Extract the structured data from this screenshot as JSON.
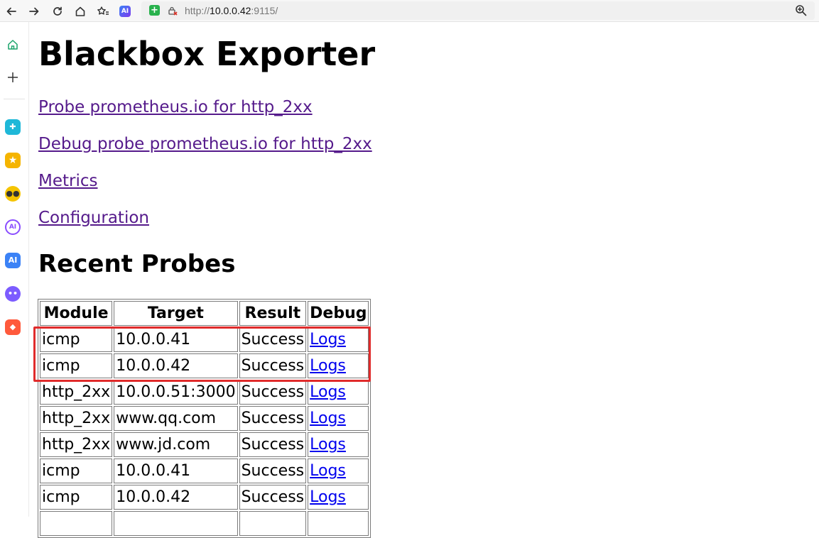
{
  "browser": {
    "url_scheme": "http://",
    "url_host": "10.0.0.42",
    "url_rest": ":9115/",
    "toolbar_icons": [
      "back-icon",
      "forward-icon",
      "reload-icon",
      "home-icon",
      "favorites-icon",
      "ai-icon"
    ],
    "ai_badge": "AI"
  },
  "sidebar": {
    "items": [
      {
        "name": "home-icon"
      },
      {
        "name": "add-icon"
      },
      {
        "name": "app-icon-1",
        "color": "#1fb8d8"
      },
      {
        "name": "app-icon-star",
        "color": "#f5b400"
      },
      {
        "name": "app-icon-bot",
        "color": "#f5b400"
      },
      {
        "name": "app-icon-ai-ring",
        "label": "AI",
        "color": "#8a4dff"
      },
      {
        "name": "app-icon-ai",
        "label": "AI",
        "color": "#3b82f6"
      },
      {
        "name": "app-icon-ghost",
        "color": "#7c5cff"
      },
      {
        "name": "app-icon-game",
        "color": "#ff5a3c"
      }
    ]
  },
  "page": {
    "title": "Blackbox Exporter",
    "links": [
      "Probe prometheus.io for http_2xx",
      "Debug probe prometheus.io for http_2xx",
      "Metrics",
      "Configuration"
    ],
    "section_title": "Recent Probes",
    "table": {
      "headers": [
        "Module",
        "Target",
        "Result",
        "Debug"
      ],
      "rows": [
        [
          "icmp",
          "10.0.0.41",
          "Success",
          "Logs"
        ],
        [
          "icmp",
          "10.0.0.42",
          "Success",
          "Logs"
        ],
        [
          "http_2xx",
          "10.0.0.51:3000",
          "Success",
          "Logs"
        ],
        [
          "http_2xx",
          "www.qq.com",
          "Success",
          "Logs"
        ],
        [
          "http_2xx",
          "www.jd.com",
          "Success",
          "Logs"
        ],
        [
          "icmp",
          "10.0.0.41",
          "Success",
          "Logs"
        ],
        [
          "icmp",
          "10.0.0.42",
          "Success",
          "Logs"
        ],
        [
          "",
          "",
          "",
          ""
        ]
      ]
    },
    "highlight_color": "#e02b2b"
  }
}
